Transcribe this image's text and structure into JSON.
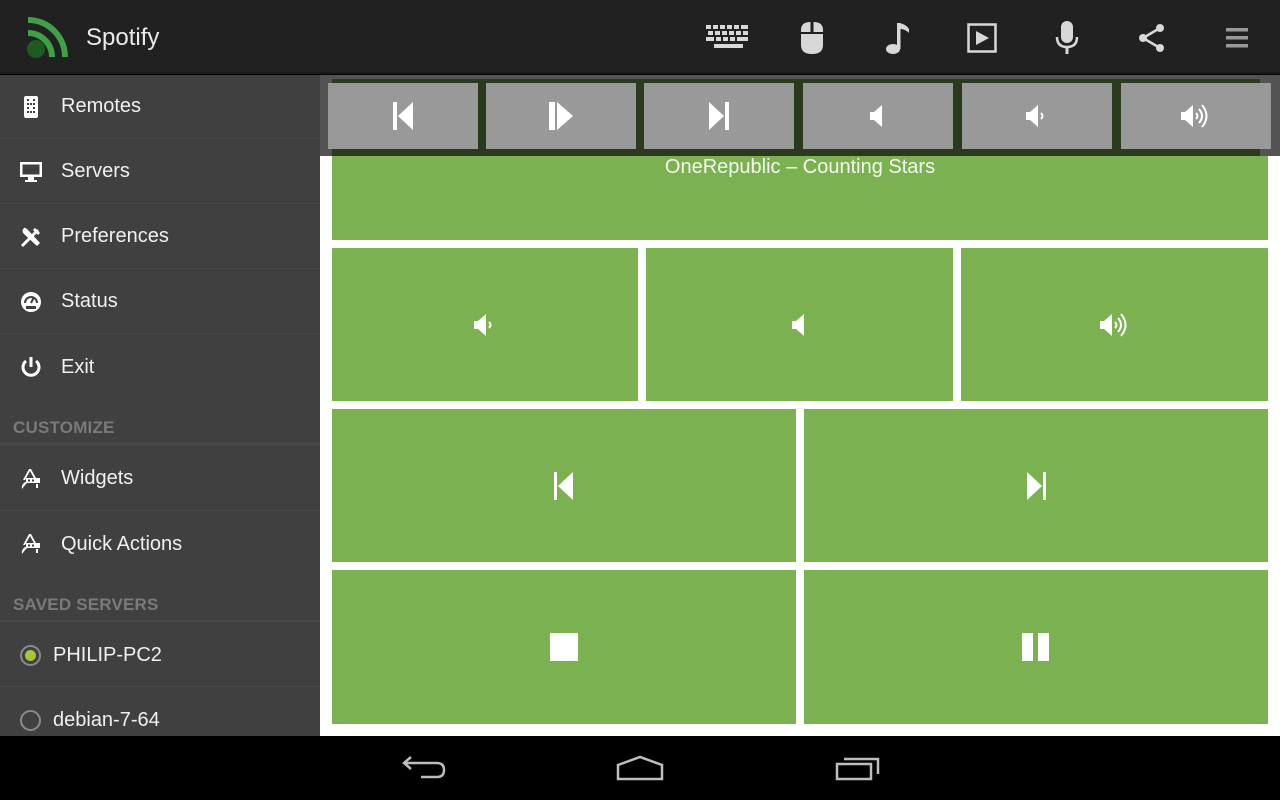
{
  "app": {
    "title": "Spotify",
    "accent_color": "#a4c639",
    "tile_color": "#7cb152"
  },
  "actionbar": {
    "icons": [
      {
        "name": "keyboard-icon",
        "label": "Keyboard"
      },
      {
        "name": "mouse-icon",
        "label": "Mouse"
      },
      {
        "name": "music-note-icon",
        "label": "Media"
      },
      {
        "name": "play-box-icon",
        "label": "Player"
      },
      {
        "name": "microphone-icon",
        "label": "Voice"
      },
      {
        "name": "share-icon",
        "label": "Share"
      },
      {
        "name": "menu-icon",
        "label": "Menu"
      }
    ]
  },
  "sidebar": {
    "items": [
      {
        "label": "Remotes",
        "icon": "remote-icon"
      },
      {
        "label": "Servers",
        "icon": "monitor-icon"
      },
      {
        "label": "Preferences",
        "icon": "tools-icon"
      },
      {
        "label": "Status",
        "icon": "gauge-icon"
      },
      {
        "label": "Exit",
        "icon": "power-icon"
      }
    ],
    "customize_header": "CUSTOMIZE",
    "customize_items": [
      {
        "label": "Widgets",
        "icon": "design-icon"
      },
      {
        "label": "Quick Actions",
        "icon": "design-icon"
      }
    ],
    "saved_servers_header": "SAVED SERVERS",
    "servers": [
      {
        "label": "PHILIP-PC2",
        "selected": true
      },
      {
        "label": "debian-7-64",
        "selected": false
      }
    ]
  },
  "quickbar": {
    "buttons": [
      {
        "name": "previous-button",
        "icon": "skip-previous-icon"
      },
      {
        "name": "play-pause-button",
        "icon": "play-pause-icon"
      },
      {
        "name": "next-button",
        "icon": "skip-next-icon"
      },
      {
        "name": "volume-mute-button",
        "icon": "volume-mute-icon"
      },
      {
        "name": "volume-down-button",
        "icon": "volume-down-icon"
      },
      {
        "name": "volume-up-button",
        "icon": "volume-up-icon"
      }
    ]
  },
  "remote": {
    "now_playing": "OneRepublic – Counting Stars",
    "tiles": [
      {
        "name": "volume-down-tile",
        "icon": "volume-down-icon"
      },
      {
        "name": "mute-tile",
        "icon": "volume-mute-icon"
      },
      {
        "name": "volume-up-tile",
        "icon": "volume-up-icon"
      },
      {
        "name": "previous-tile",
        "icon": "skip-previous-icon"
      },
      {
        "name": "next-tile",
        "icon": "skip-next-icon"
      },
      {
        "name": "stop-tile",
        "icon": "stop-icon"
      },
      {
        "name": "pause-tile",
        "icon": "pause-icon"
      }
    ]
  },
  "system_nav": {
    "buttons": [
      {
        "name": "back-button",
        "icon": "back-icon"
      },
      {
        "name": "home-button",
        "icon": "home-icon"
      },
      {
        "name": "recents-button",
        "icon": "recents-icon"
      }
    ]
  }
}
